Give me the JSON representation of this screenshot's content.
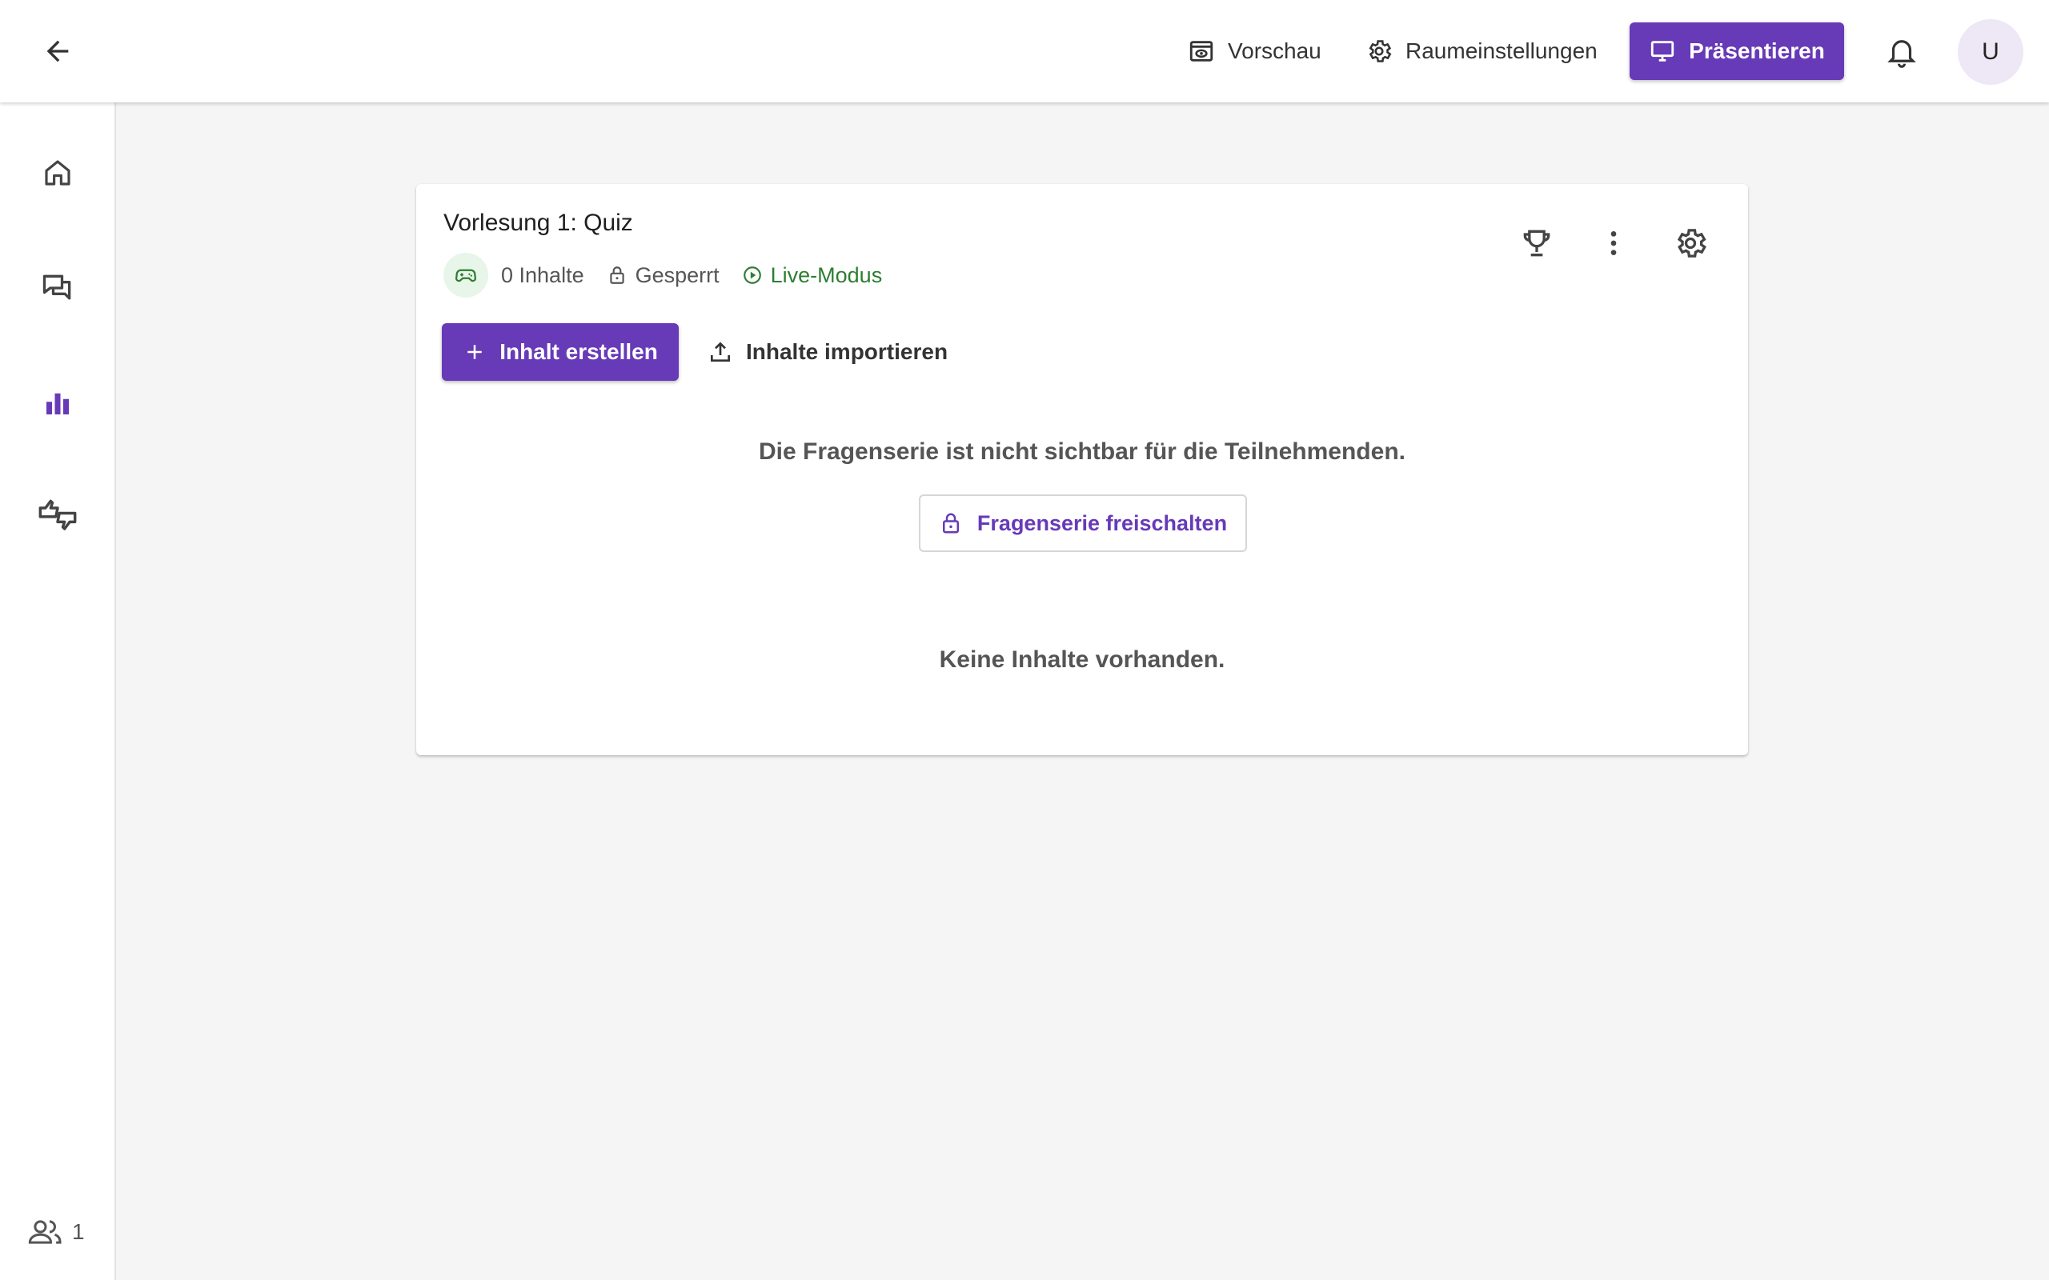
{
  "header": {
    "back_label": "Zurück",
    "preview_label": "Vorschau",
    "room_settings_label": "Raumeinstellungen",
    "present_label": "Präsentieren",
    "avatar_initial": "U",
    "accent_color": "#673ab7"
  },
  "sidebar": {
    "items": [
      {
        "icon": "home-icon"
      },
      {
        "icon": "comments-icon"
      },
      {
        "icon": "bar-chart-icon",
        "active": true
      },
      {
        "icon": "feedback-icon"
      }
    ],
    "online_count": "1"
  },
  "series": {
    "title": "Vorlesung 1: Quiz",
    "content_count": "0 Inhalte",
    "lock_status": "Gesperrt",
    "mode": "Live-Modus",
    "create_label": "Inhalt erstellen",
    "import_label": "Inhalte importieren",
    "hidden_note": "Die Fragenserie ist nicht sichtbar für die Teilnehmenden.",
    "unlock_label": "Fragenserie freischalten",
    "empty_note": "Keine Inhalte vorhanden."
  }
}
